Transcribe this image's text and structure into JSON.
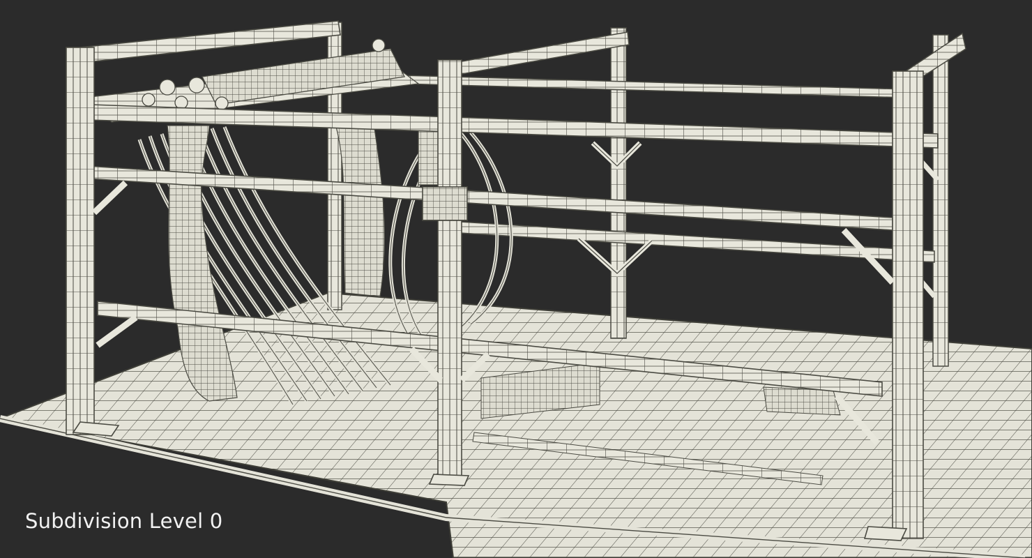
{
  "caption": "Subdivision Level 0",
  "colors": {
    "background": "#2b2b2b",
    "wire_fill": "#e9e8dd",
    "wire_stroke": "#48483f",
    "caption_text": "#f2f2f2"
  },
  "icons": {
    "model": "wireframe-gantry-model"
  }
}
